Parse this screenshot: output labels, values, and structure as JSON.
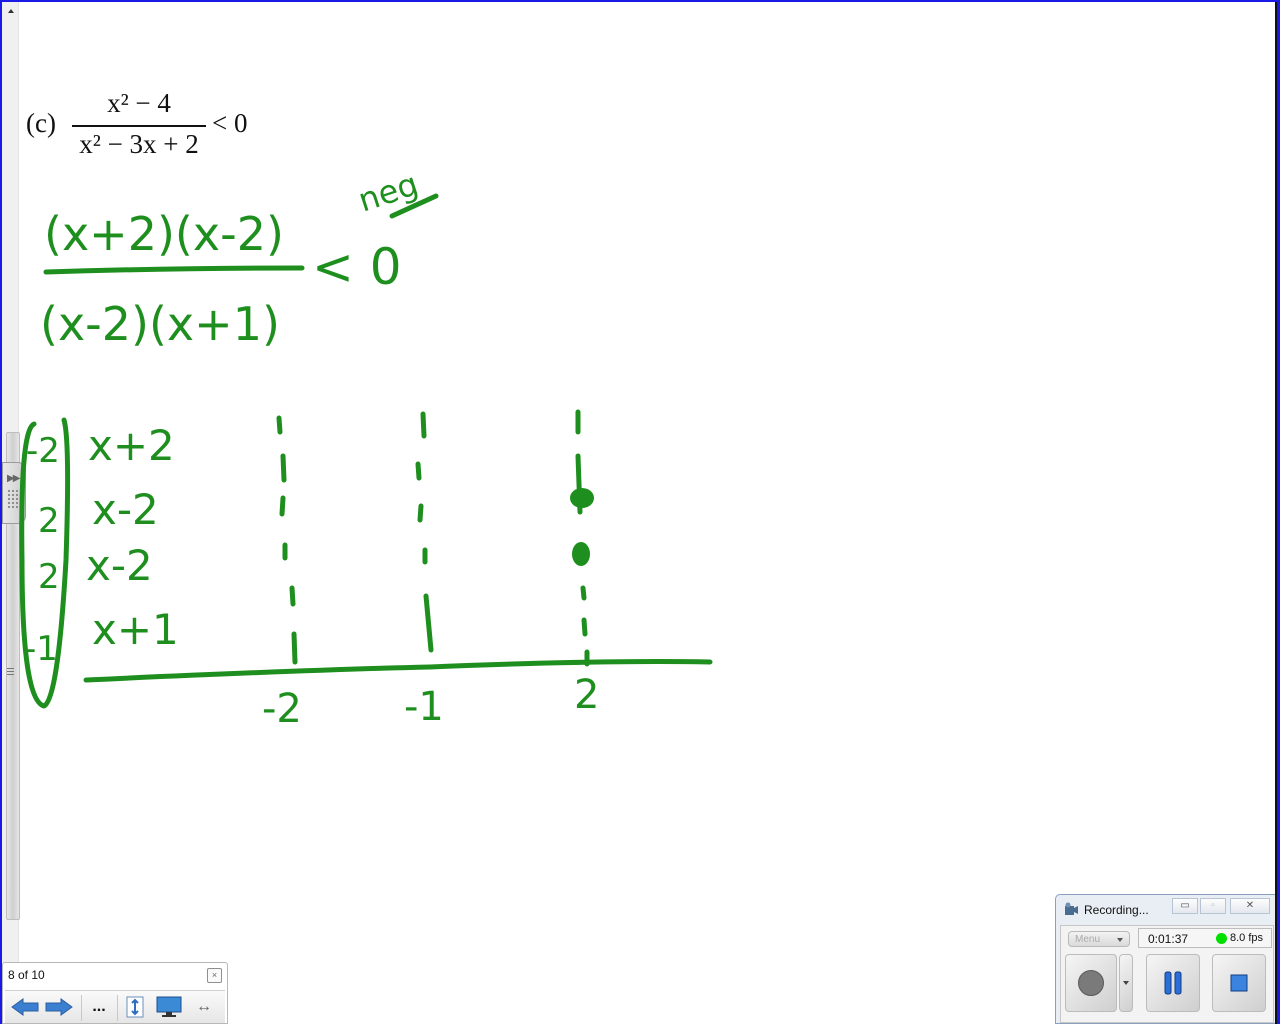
{
  "problem": {
    "label": "(c)",
    "numerator": "x² − 4",
    "denominator": "x² − 3x + 2",
    "relation": "< 0"
  },
  "handwriting": {
    "color": "#1e8f1e",
    "factored_numerator": "(x+2)(x-2)",
    "factored_denominator": "(x-2)(x+1)",
    "relation": "< 0",
    "annotation": "neg",
    "critical_values": [
      "-2",
      "2",
      "2",
      "-1"
    ],
    "factor_rows": [
      "x+2",
      "x-2",
      "x-2",
      "x+1"
    ],
    "number_line_labels": [
      "-2",
      "-1",
      "2"
    ]
  },
  "navigator": {
    "page_indicator": "8 of 10",
    "close_icon": "×",
    "more_label": "..."
  },
  "recorder": {
    "title": "Recording...",
    "menu_label": "Menu",
    "elapsed": "0:01:37",
    "fps": "8.0 fps",
    "status_color": "#00e000"
  }
}
